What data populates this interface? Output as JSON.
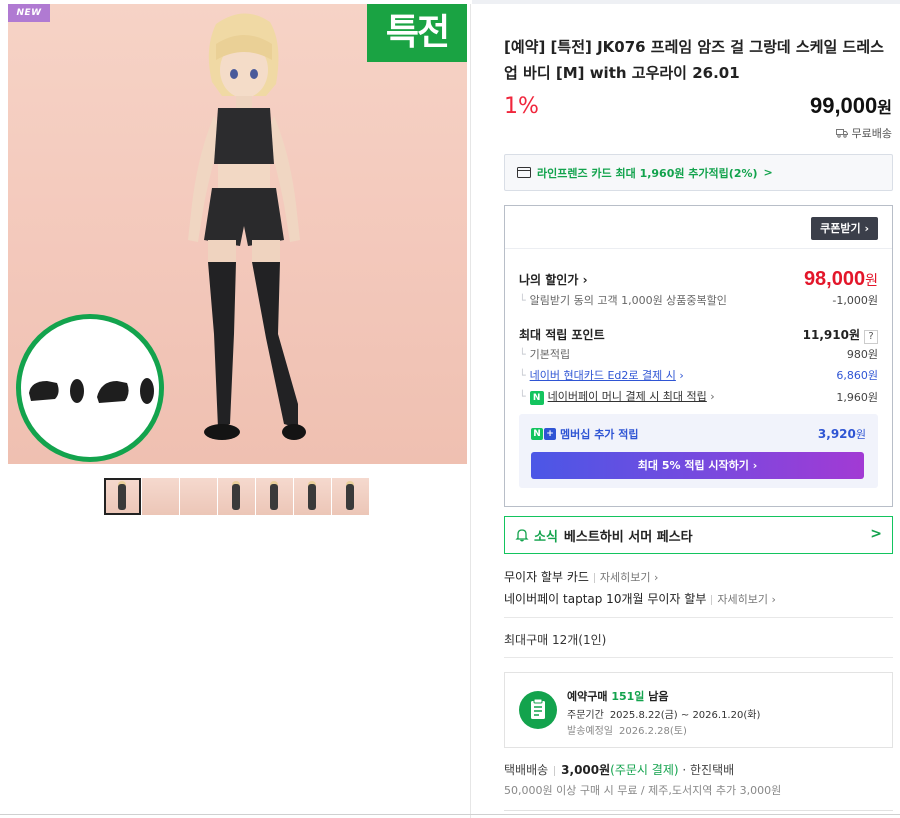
{
  "gallery": {
    "badge_new": "NEW",
    "badge_special": "특전",
    "thumbnail_count": 7
  },
  "product": {
    "title": "[예약] [특전] JK076 프레임 암즈 걸 그랑데 스케일 드레스 업 바디 [M] with 고우라이 26.01",
    "discount_rate": "1%",
    "price_amount": "99,000",
    "price_unit": "원",
    "shipping_free": "무료배송"
  },
  "card_promo": {
    "text": "라인프렌즈 카드 최대 1,960원 추가적립(2%)",
    "chevron": ">"
  },
  "benefits": {
    "coupon_button": "쿠폰받기",
    "my_price_label": "나의 할인가",
    "my_price_amount": "98,000",
    "my_price_unit": "원",
    "alert_discount_label": "알림받기 동의 고객 1,000원 상품중복할인",
    "alert_discount_value": "-1,000원",
    "max_points_label": "최대 적립 포인트",
    "max_points_value": "11,910원",
    "help_mark": "?",
    "basic_label": "기본적립",
    "basic_value": "980원",
    "card_label": "네이버 현대카드 Ed2로 결제 시",
    "card_value": "6,860원",
    "npay_badge": "N",
    "npay_label": "네이버페이 머니 결제 시 최대 적립",
    "npay_value": "1,960원",
    "membership_label": "멤버십 추가 적립",
    "membership_amount": "3,920",
    "membership_unit": "원",
    "membership_button": "최대 5% 적립 시작하기"
  },
  "news": {
    "tag": "소식",
    "text": "베스트하비 서머 페스타",
    "chevron": ">"
  },
  "installments": [
    {
      "label": "무이자 할부 카드",
      "more": "자세히보기"
    },
    {
      "label": "네이버페이 taptap 10개월 무이자 할부",
      "more": "자세히보기"
    }
  ],
  "max_purchase": "최대구매 12개(1인)",
  "reservation": {
    "title_prefix": "예약구매",
    "days": "151일",
    "title_suffix": "남음",
    "order_period_label": "주문기간",
    "order_period_value": "2025.8.22(금) ~ 2026.1.20(화)",
    "ship_date_label": "발송예정일",
    "ship_date_value": "2026.2.28(토)"
  },
  "shipping": {
    "method": "택배배송",
    "fee": "3,000원",
    "fee_note": "(주문시 결제)",
    "carrier": "· 한진택배",
    "note": "50,000원 이상 구매 시 무료 / 제주,도서지역 추가 3,000원"
  },
  "colors": {
    "accent_green": "#13a34d",
    "price_red": "#e3162a",
    "link_blue": "#2f55d4",
    "badge_purple": "#b07ad2"
  }
}
